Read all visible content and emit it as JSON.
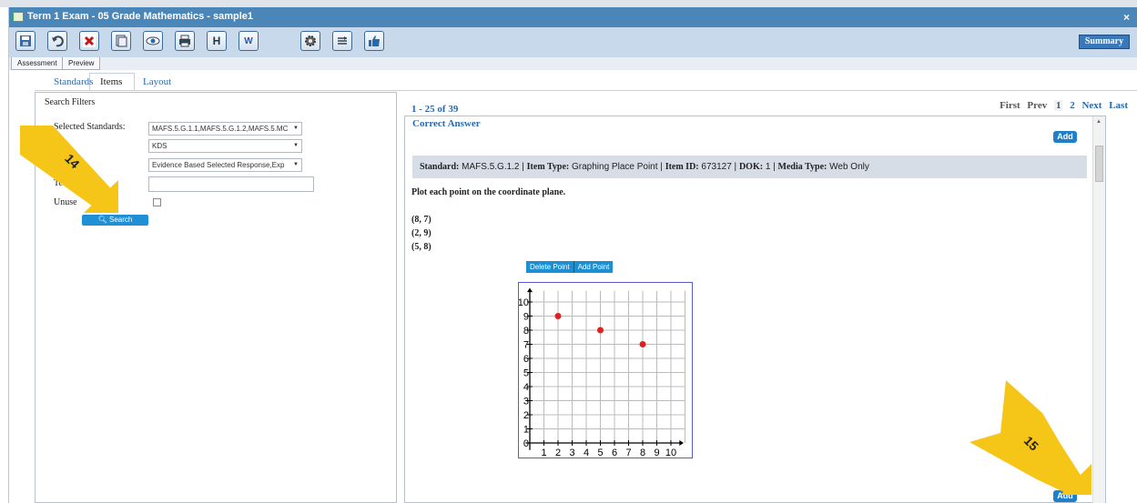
{
  "window": {
    "title": "Term 1 Exam - 05 Grade Mathematics - sample1",
    "close_label": "×"
  },
  "toolbar": {
    "buttons": [
      {
        "icon": "save-icon"
      },
      {
        "icon": "undo-icon"
      },
      {
        "icon": "delete-icon"
      },
      {
        "icon": "copy-icon"
      },
      {
        "icon": "preview-eye-icon"
      },
      {
        "icon": "print-icon"
      },
      {
        "icon": "header-icon",
        "glyph": "H"
      },
      {
        "icon": "word-export-icon",
        "glyph": "W"
      },
      {
        "icon": "settings-icon"
      },
      {
        "icon": "sort-icon"
      },
      {
        "icon": "thumbs-up-icon"
      }
    ],
    "summary_label": "Summary"
  },
  "subtabs": [
    "Assessment",
    "Preview"
  ],
  "main_tabs": [
    "Standards",
    "Items",
    "Layout"
  ],
  "search_filters": {
    "heading": "Search Filters",
    "selected_standards_label": "Selected Standards:",
    "selected_standards_value": "MAFS.5.G.1.1,MAFS.5.G.1.2,MAFS.5.MC",
    "dok_value": "KDS",
    "item_type_value": "Evidence Based Selected Response,Exp",
    "text_label": "Te",
    "unused_label": "Unuse",
    "search_button": "Search"
  },
  "results": {
    "range": "1 - 25 of 39",
    "pager": {
      "first": "First",
      "prev": "Prev",
      "pages": [
        "1",
        "2"
      ],
      "next": "Next",
      "last": "Last"
    },
    "correct_answer": "Correct Answer",
    "add_label": "Add",
    "standard_label": "Standard:",
    "standard_value": "MAFS.5.G.1.2",
    "item_type_label": "Item Type:",
    "item_type_value": "Graphing Place Point",
    "item_id_label": "Item ID:",
    "item_id_value": "673127",
    "dok_label": "DOK:",
    "dok_value": "1",
    "media_type_label": "Media Type:",
    "media_type_value": "Web Only",
    "question": "Plot each point on the coordinate plane.",
    "points": [
      "(8, 7)",
      "(2, 9)",
      "(5, 8)"
    ],
    "graph_buttons": [
      "Delete Point",
      "Add Point"
    ]
  },
  "chart_data": {
    "type": "scatter",
    "x_ticks": [
      "1",
      "2",
      "3",
      "4",
      "5",
      "6",
      "7",
      "8",
      "9",
      "10"
    ],
    "y_ticks": [
      "1",
      "2",
      "3",
      "4",
      "5",
      "6",
      "7",
      "8",
      "9",
      "10"
    ],
    "origin_label": "0",
    "xlim": [
      0,
      10
    ],
    "ylim": [
      0,
      10
    ],
    "grid": true,
    "points": [
      {
        "x": 2,
        "y": 9
      },
      {
        "x": 5,
        "y": 8
      },
      {
        "x": 8,
        "y": 7
      }
    ],
    "point_color": "#e02020"
  },
  "annotations": [
    "14",
    "15"
  ],
  "colors": {
    "titlebar": "#4b86b8",
    "toolbar": "#c9d9ec",
    "accent_button": "#1f7fc9",
    "annotation_arrow": "#f5c518"
  }
}
